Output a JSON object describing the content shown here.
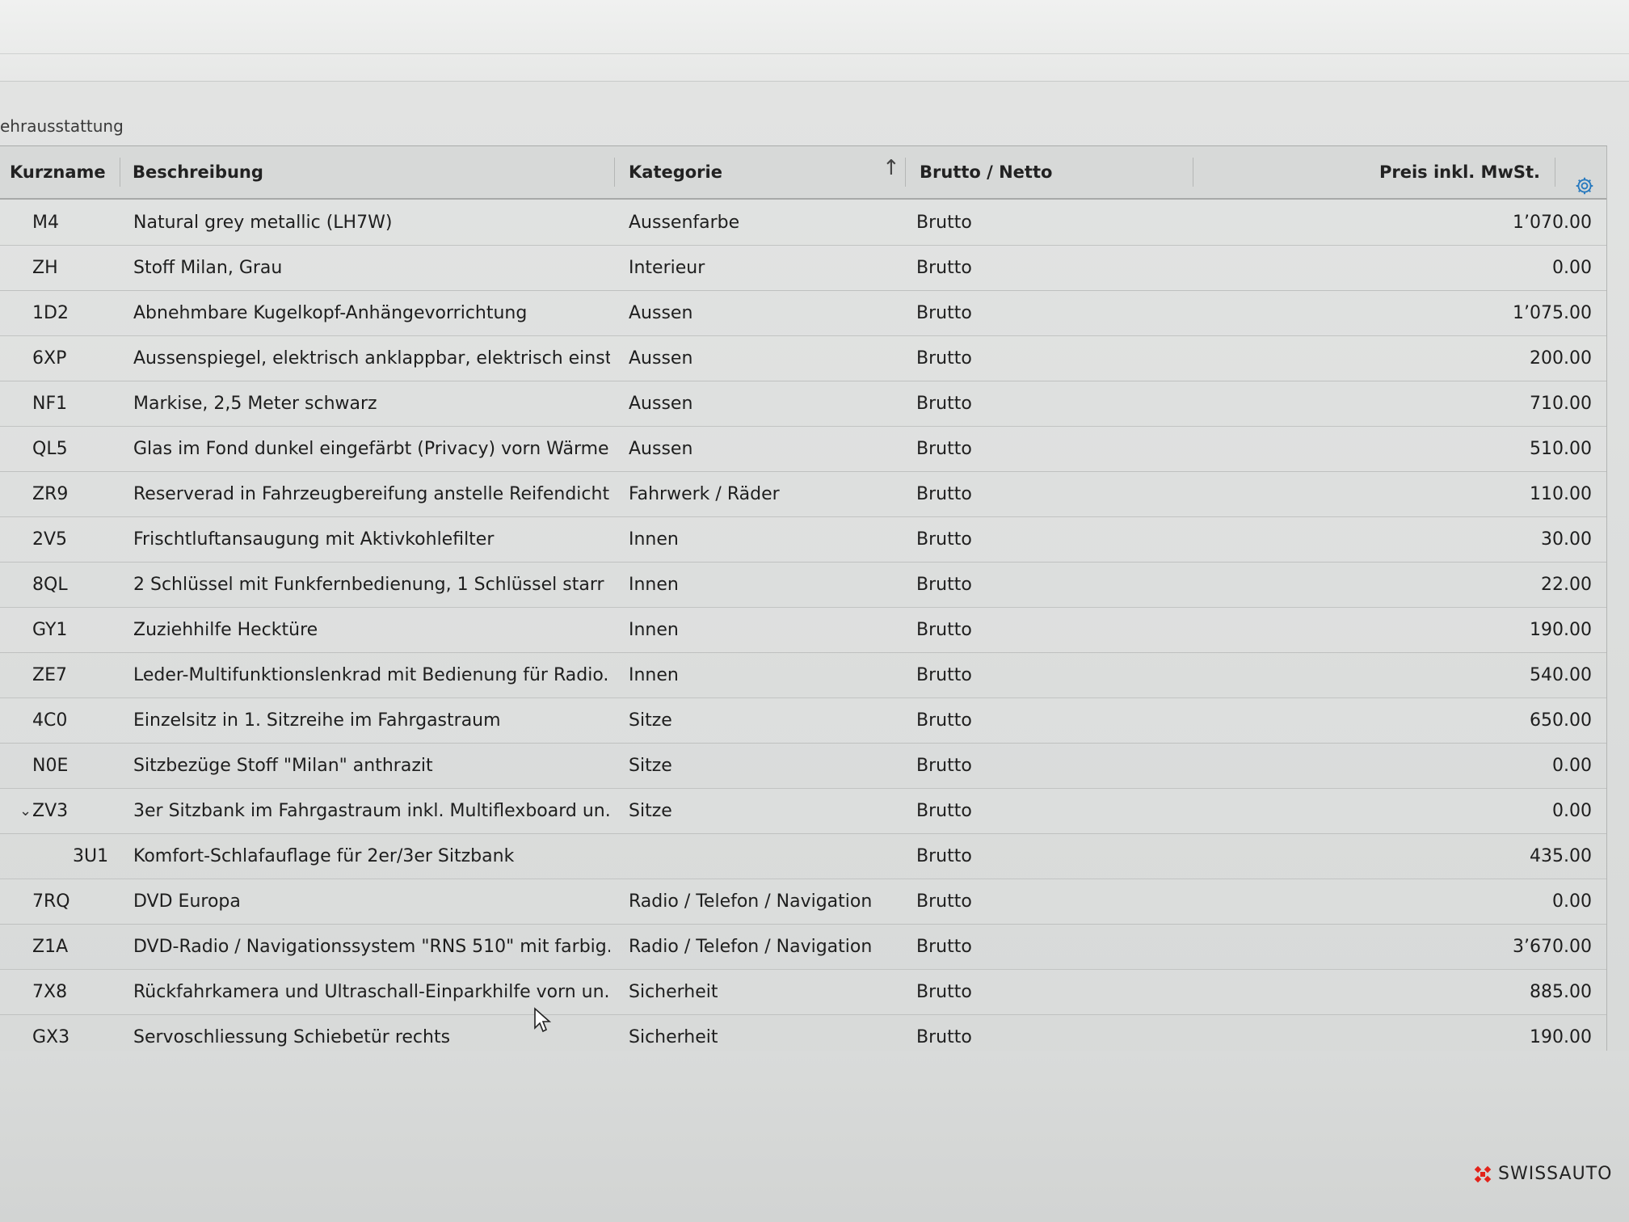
{
  "section_title": "ehrausstattung",
  "columns": {
    "code": "Kurzname",
    "description": "Beschreibung",
    "category": "Kategorie",
    "gross_net": "Brutto / Netto",
    "price": "Preis inkl. MwSt."
  },
  "sort_indicator": "↑",
  "rows": [
    {
      "code": "M4",
      "description": "Natural grey metallic (LH7W)",
      "category": "Aussenfarbe",
      "gross_net": "Brutto",
      "price": "1’070.00"
    },
    {
      "code": "ZH",
      "description": "Stoff Milan, Grau",
      "category": "Interieur",
      "gross_net": "Brutto",
      "price": "0.00"
    },
    {
      "code": "1D2",
      "description": "Abnehmbare Kugelkopf-Anhängevorrichtung",
      "category": "Aussen",
      "gross_net": "Brutto",
      "price": "1’075.00"
    },
    {
      "code": "6XP",
      "description": "Aussenspiegel, elektrisch anklappbar, elektrisch einst...",
      "category": "Aussen",
      "gross_net": "Brutto",
      "price": "200.00"
    },
    {
      "code": "NF1",
      "description": "Markise, 2,5 Meter schwarz",
      "category": "Aussen",
      "gross_net": "Brutto",
      "price": "710.00"
    },
    {
      "code": "QL5",
      "description": "Glas im Fond dunkel eingefärbt (Privacy) vorn Wärme...",
      "category": "Aussen",
      "gross_net": "Brutto",
      "price": "510.00"
    },
    {
      "code": "ZR9",
      "description": "Reserverad in Fahrzeugbereifung anstelle Reifendicht...",
      "category": "Fahrwerk / Räder",
      "gross_net": "Brutto",
      "price": "110.00"
    },
    {
      "code": "2V5",
      "description": "Frischtluftansaugung mit Aktivkohlefilter",
      "category": "Innen",
      "gross_net": "Brutto",
      "price": "30.00"
    },
    {
      "code": "8QL",
      "description": "2 Schlüssel mit Funkfernbedienung, 1 Schlüssel starr",
      "category": "Innen",
      "gross_net": "Brutto",
      "price": "22.00"
    },
    {
      "code": "GY1",
      "description": "Zuziehhilfe Hecktüre",
      "category": "Innen",
      "gross_net": "Brutto",
      "price": "190.00"
    },
    {
      "code": "ZE7",
      "description": "Leder-Multifunktionslenkrad mit Bedienung für Radio...",
      "category": "Innen",
      "gross_net": "Brutto",
      "price": "540.00"
    },
    {
      "code": "4C0",
      "description": "Einzelsitz in 1. Sitzreihe im Fahrgastraum",
      "category": "Sitze",
      "gross_net": "Brutto",
      "price": "650.00"
    },
    {
      "code": "N0E",
      "description": "Sitzbezüge Stoff \"Milan\" anthrazit",
      "category": "Sitze",
      "gross_net": "Brutto",
      "price": "0.00"
    },
    {
      "code": "ZV3",
      "description": "3er Sitzbank im Fahrgastraum inkl. Multiflexboard un...",
      "category": "Sitze",
      "gross_net": "Brutto",
      "price": "0.00",
      "expander": "⌄"
    },
    {
      "code": "3U1",
      "description": "Komfort-Schlafauflage für 2er/3er Sitzbank",
      "category": "",
      "gross_net": "Brutto",
      "price": "435.00",
      "child": true
    },
    {
      "code": "7RQ",
      "description": "DVD Europa",
      "category": "Radio / Telefon / Navigation",
      "gross_net": "Brutto",
      "price": "0.00"
    },
    {
      "code": "Z1A",
      "description": "DVD-Radio / Navigationssystem \"RNS 510\" mit farbig...",
      "category": "Radio / Telefon / Navigation",
      "gross_net": "Brutto",
      "price": "3’670.00"
    },
    {
      "code": "7X8",
      "description": "Rückfahrkamera und Ultraschall-Einparkhilfe vorn un...",
      "category": "Sicherheit",
      "gross_net": "Brutto",
      "price": "885.00"
    },
    {
      "code": "GX3",
      "description": "Servoschliessung Schiebetür rechts",
      "category": "Sicherheit",
      "gross_net": "Brutto",
      "price": "190.00"
    }
  ],
  "logo": {
    "text": "SWISSAUTO",
    "color": "#e2231a"
  },
  "colors": {
    "accent_icon": "#2a7bbf"
  }
}
